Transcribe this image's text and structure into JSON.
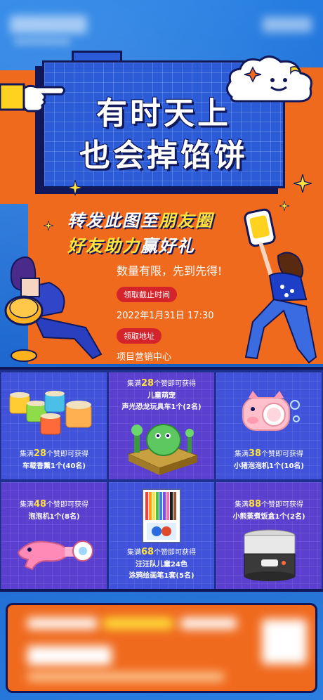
{
  "title": {
    "line1": "有时天上",
    "line2": "也会掉馅饼"
  },
  "slogan": {
    "line1_pre": "转发此图至",
    "line1_highlight": "朋友圈",
    "line2_pre": "好友",
    "line2_highlight": "助力",
    "line2_post": "赢好礼"
  },
  "info": {
    "limited": "数量有限，先到先得!",
    "deadline_label": "领取截止时间",
    "deadline_value": "2022年1月31日 17:30",
    "address_label": "领取地址",
    "address_value": "项目营销中心"
  },
  "prizes": [
    {
      "pre": "集满",
      "num": "28",
      "post": "个赞即可获得",
      "prize": "车载香薰1个(40名)"
    },
    {
      "pre": "集满",
      "num": "28",
      "post": "个赞即可获得",
      "prize_line1": "儿童萌宠",
      "prize_line2": "声光恐龙玩具车1个(2名)"
    },
    {
      "pre": "集满",
      "num": "38",
      "post": "个赞即可获得",
      "prize": "小猪泡泡机1个(10名)"
    },
    {
      "pre": "集满",
      "num": "48",
      "post": "个赞即可获得",
      "prize": "泡泡机1个(8名)"
    },
    {
      "pre": "集满",
      "num": "68",
      "post": "个赞即可获得",
      "prize_line1": "汪汪队儿童24色",
      "prize_line2": "涂鸦绘画笔1套(5名)"
    },
    {
      "pre": "集满",
      "num": "88",
      "post": "个赞即可获得",
      "prize": "小熊蒸煮饭盒1个(2名)"
    }
  ],
  "colors": {
    "accent_orange": "#f06a1e",
    "accent_yellow": "#ffe23b",
    "pill_red": "#d4232b",
    "navy": "#10185a"
  }
}
